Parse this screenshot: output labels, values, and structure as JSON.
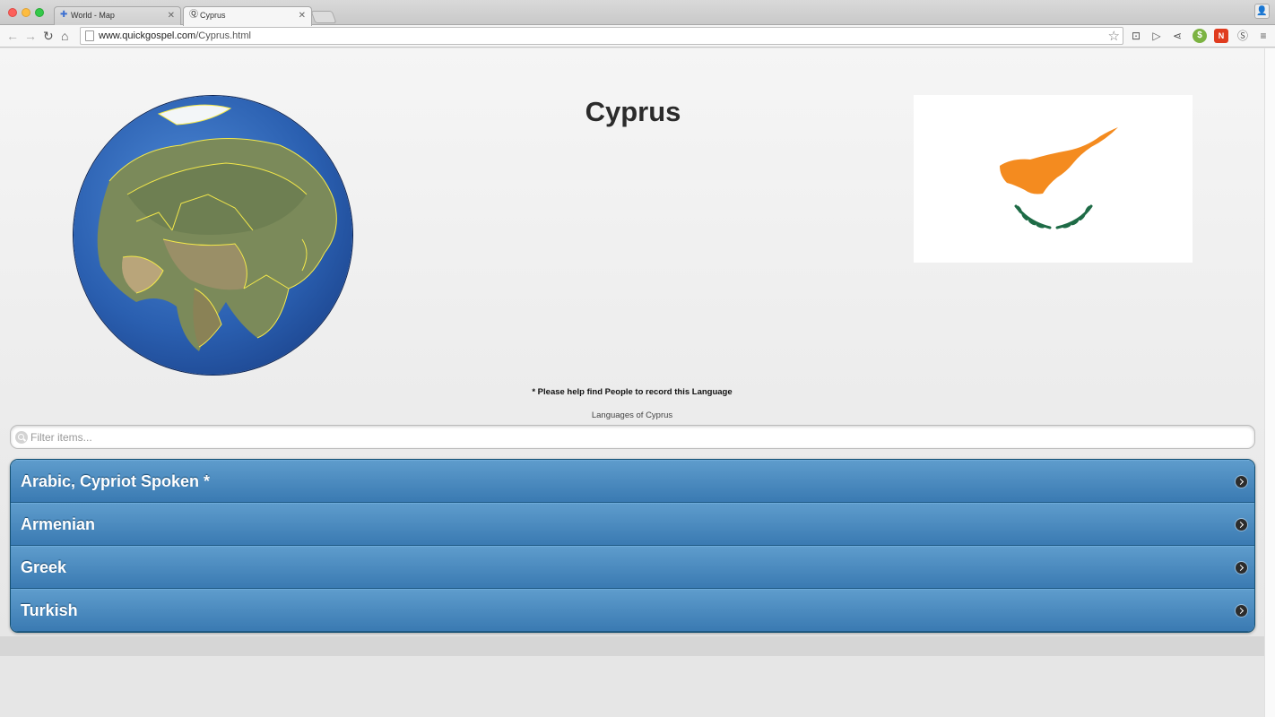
{
  "browser": {
    "tabs": [
      {
        "title": "World - Map",
        "active": false
      },
      {
        "title": "Cyprus",
        "active": true
      }
    ],
    "url_domain": "www.quickgospel.com",
    "url_path": "/Cyprus.html"
  },
  "page": {
    "title": "Cyprus",
    "help_note": "* Please help find People to record this Language",
    "list_caption": "Languages of Cyprus",
    "filter_placeholder": "Filter items...",
    "languages": [
      "Arabic, Cypriot Spoken *",
      "Armenian",
      "Greek",
      "Turkish"
    ]
  },
  "colors": {
    "list_item_top": "#5e9ccc",
    "list_item_bottom": "#3a7ab2",
    "flag_island": "#f48b1f",
    "flag_branches": "#1e6b46"
  }
}
